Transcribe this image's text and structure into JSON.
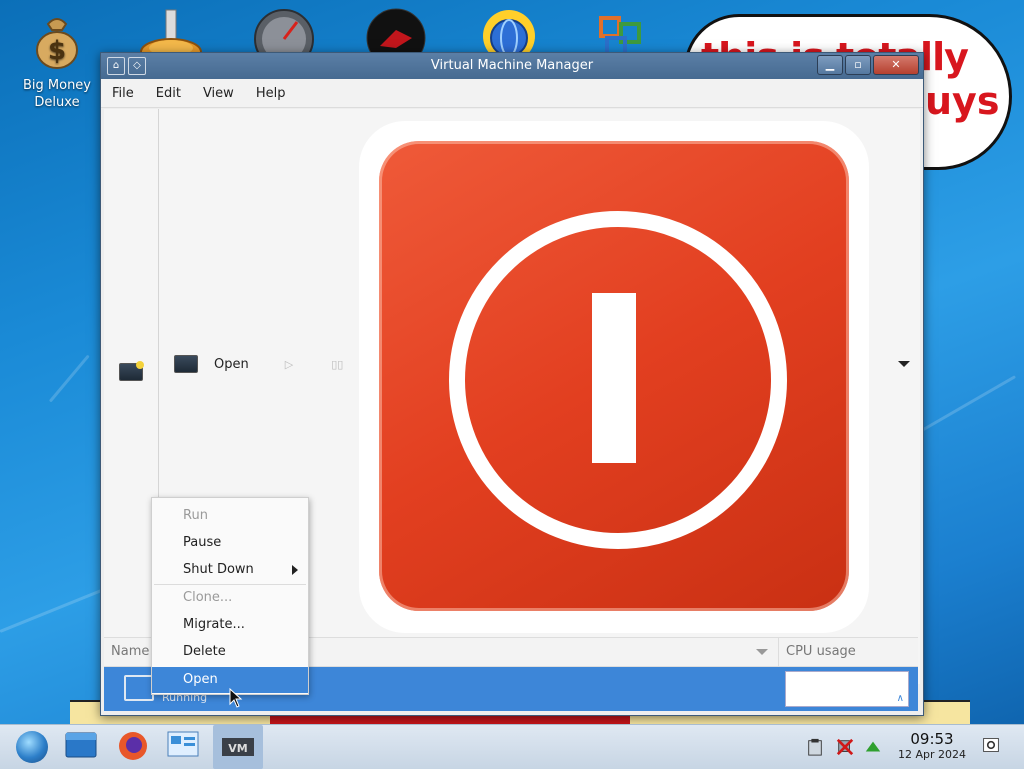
{
  "desktop": {
    "icons": [
      {
        "name": "Big Money Deluxe",
        "label_line1": "Big Money",
        "label_line2": "Deluxe"
      }
    ],
    "meme": {
      "line1": "this is totally",
      "line2": "uys"
    }
  },
  "window": {
    "title": "Virtual Machine Manager",
    "menu": [
      "File",
      "Edit",
      "View",
      "Help"
    ],
    "toolbar": {
      "open_label": "Open"
    },
    "list": {
      "col_name": "Name",
      "col_cpu": "CPU usage",
      "rows": [
        {
          "status": "Running"
        }
      ]
    }
  },
  "context_menu": {
    "items": [
      {
        "label": "Run",
        "enabled": false
      },
      {
        "label": "Pause",
        "enabled": true
      },
      {
        "label": "Shut Down",
        "enabled": true,
        "submenu": true
      },
      {
        "label": "Clone...",
        "enabled": false
      },
      {
        "label": "Migrate...",
        "enabled": true
      },
      {
        "label": "Delete",
        "enabled": true
      },
      {
        "label": "Open",
        "enabled": true,
        "selected": true
      }
    ]
  },
  "taskbar": {
    "time": "09:53",
    "date": "12 Apr 2024"
  },
  "colors": {
    "selection": "#3d86d8",
    "title_bar": "#4f739a",
    "shutdown_red": "#e23f20"
  },
  "icons": [
    "money-bag-icon",
    "gear-app-icon",
    "speedometer-icon",
    "red-disc-icon",
    "globe-sun-icon",
    "office-grid-icon",
    "start-orb-icon",
    "file-manager-icon",
    "firefox-icon",
    "control-panel-icon",
    "vmm-icon",
    "clipboard-icon",
    "network-icon",
    "upload-arrow-icon",
    "notifications-icon"
  ]
}
